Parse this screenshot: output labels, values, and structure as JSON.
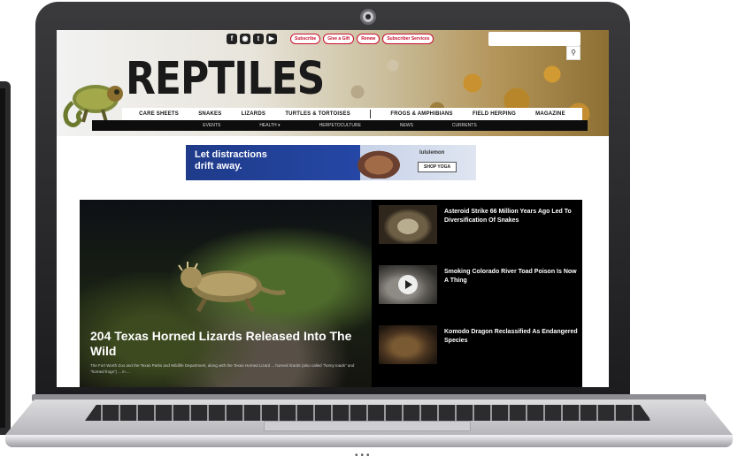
{
  "site": {
    "logo_text": "REPTILES",
    "social_icons": [
      "f",
      "◉",
      "t",
      "▶"
    ],
    "header_links": [
      "Subscribe",
      "Give a Gift",
      "Renew",
      "Subscriber Services"
    ],
    "search": {
      "placeholder": ""
    }
  },
  "nav": {
    "main": [
      "CARE SHEETS",
      "SNAKES",
      "LIZARDS",
      "TURTLES & TORTOISES",
      "FROGS & AMPHIBIANS",
      "FIELD HERPING",
      "MAGAZINE"
    ],
    "sub": [
      "EVENTS",
      "HEALTH ▾",
      "HERPETOCULTURE",
      "NEWS",
      "CURRENTS"
    ]
  },
  "ad": {
    "text_line1": "Let distractions",
    "text_line2": "drift away.",
    "brand": "lululemon",
    "cta": "SHOP YOGA"
  },
  "feature": {
    "hero_title": "204 Texas Horned Lizards Released Into The Wild",
    "hero_excerpt": "The Fort Worth Zoo and the Texas Parks and Wildlife Department, along with the Texas Horned Lizard ... horned lizards (also called \"horny toads\" and \"horned frogs\") ... in ..."
  },
  "side_stories": [
    {
      "title": "Asteroid Strike 66 Million Years Ago Led To Diversification Of Snakes"
    },
    {
      "title": "Smoking Colorado River Toad Poison Is Now A Thing"
    },
    {
      "title": "Komodo Dragon Reclassified As Endangered Species"
    }
  ],
  "colors": {
    "brand_red": "#c8102e",
    "nav_black": "#0d0d0d",
    "feature_bg": "#000000"
  }
}
